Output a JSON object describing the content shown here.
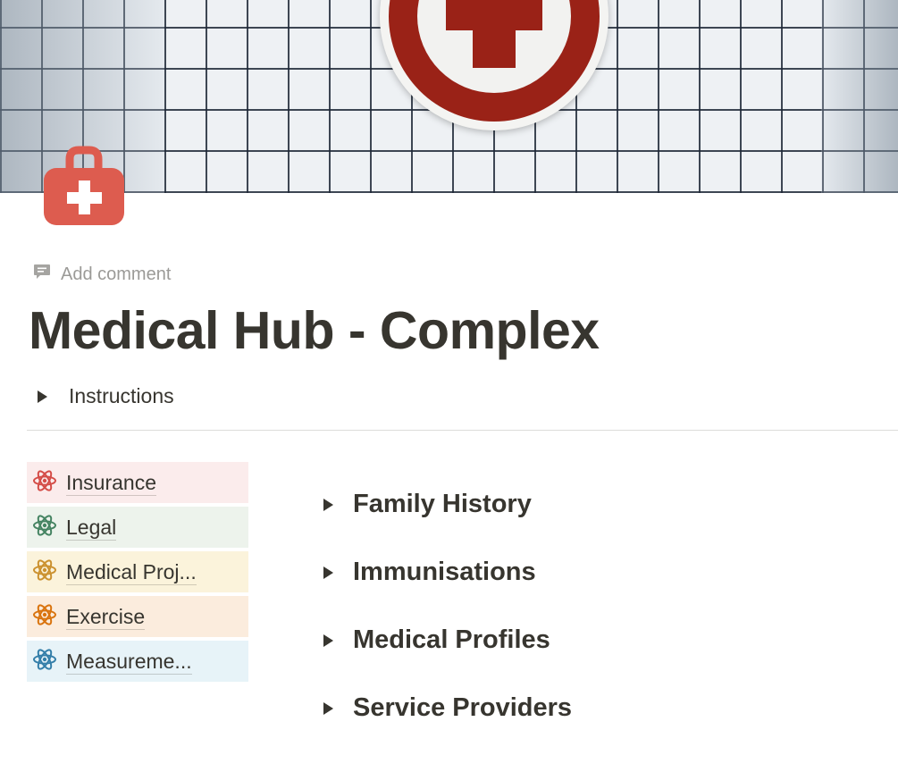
{
  "page": {
    "add_comment": "Add comment",
    "title": "Medical Hub - Complex",
    "instructions_toggle": "Instructions",
    "icon": "first-aid-kit-icon",
    "cover": "tiled-wall-with-red-cross-sign"
  },
  "nav_links": [
    {
      "label": "Insurance",
      "icon": "atom-icon",
      "color": "#d44c47",
      "bg": "#fbecec"
    },
    {
      "label": "Legal",
      "icon": "atom-icon",
      "color": "#448361",
      "bg": "#edf3ec"
    },
    {
      "label": "Medical Proj...",
      "icon": "atom-icon",
      "color": "#cb912f",
      "bg": "#fbf3db"
    },
    {
      "label": "Exercise",
      "icon": "atom-icon",
      "color": "#d9730d",
      "bg": "#fbecdd"
    },
    {
      "label": "Measureme...",
      "icon": "atom-icon",
      "color": "#337ea9",
      "bg": "#e7f3f8"
    }
  ],
  "sections": [
    {
      "label": "Family History"
    },
    {
      "label": "Immunisations"
    },
    {
      "label": "Medical Profiles"
    },
    {
      "label": "Service Providers"
    }
  ],
  "colors": {
    "text": "#37352f",
    "muted": "#9b9a97",
    "icon_red": "#dd5c4f",
    "cross_red": "#9a2217"
  }
}
